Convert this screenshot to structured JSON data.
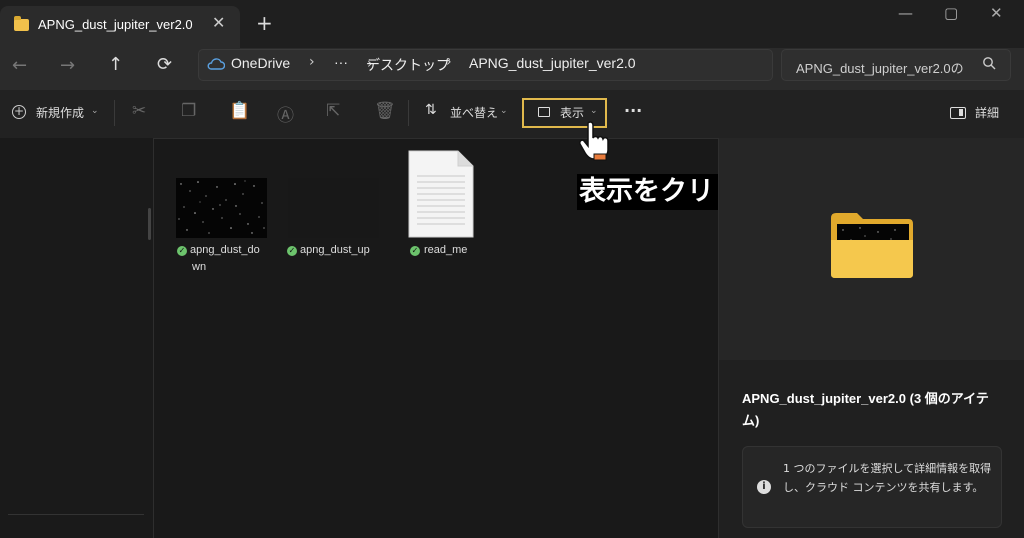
{
  "window": {
    "tab_title": "APNG_dust_jupiter_ver2.0",
    "tab_close": "✕",
    "new_tab": "+",
    "minimize": "—",
    "maximize": "▢",
    "close": "✕"
  },
  "nav": {
    "back": "←",
    "forward": "→",
    "up": "↑",
    "refresh": "⟳",
    "breadcrumb": [
      "OneDrive",
      "デスクトップ",
      "APNG_dust_jupiter_ver2.0"
    ],
    "overflow": "···",
    "sep": "›",
    "search_placeholder": "APNG_dust_jupiter_ver2.0の",
    "search_icon": "search-icon"
  },
  "toolbar": {
    "new_label": "新規作成",
    "sort_label": "並べ替え",
    "view_label": "表示",
    "more_label": "···",
    "details_label": "詳細",
    "icons": [
      "cut-icon",
      "copy-icon",
      "paste-icon",
      "rename-icon",
      "share-icon",
      "delete-icon"
    ]
  },
  "files": [
    {
      "name_line1": "apng_dust_do",
      "name_line2": "wn",
      "type": "image"
    },
    {
      "name_line1": "apng_dust_up",
      "name_line2": "",
      "type": "image"
    },
    {
      "name_line1": "read_me",
      "name_line2": "",
      "type": "text"
    }
  ],
  "details": {
    "title": "APNG_dust_jupiter_ver2.0 (3 個のアイテム)",
    "info_text": "1 つのファイルを選択して詳細情報を取得し、クラウド コンテンツを共有します。"
  },
  "annotation": {
    "text": "表示をクリック"
  },
  "colors": {
    "highlight": "#e0b94c",
    "check": "#6cc36c",
    "folder": "#f2c14b"
  }
}
